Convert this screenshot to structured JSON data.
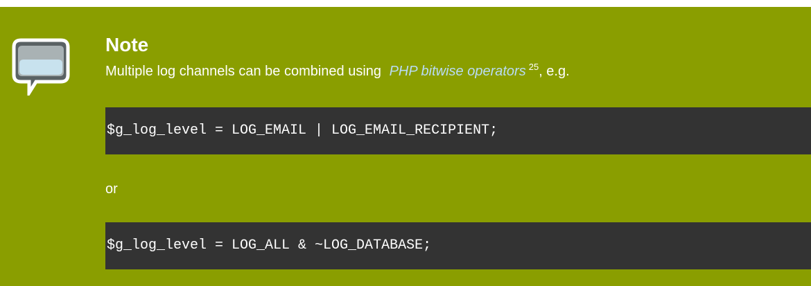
{
  "note": {
    "title": "Note",
    "text_before": "Multiple log channels can be combined using",
    "link_text": "PHP bitwise operators",
    "footnote": "25",
    "text_after": ", e.g.",
    "code_1": "$g_log_level = LOG_EMAIL | LOG_EMAIL_RECIPIENT;",
    "separator": "or",
    "code_2": "$g_log_level = LOG_ALL & ~LOG_DATABASE;",
    "icon": "speech-bubble-icon"
  },
  "colors": {
    "background": "#8a9e00",
    "code_background": "#333333",
    "link": "#b9dcf6",
    "text": "#ffffff"
  }
}
